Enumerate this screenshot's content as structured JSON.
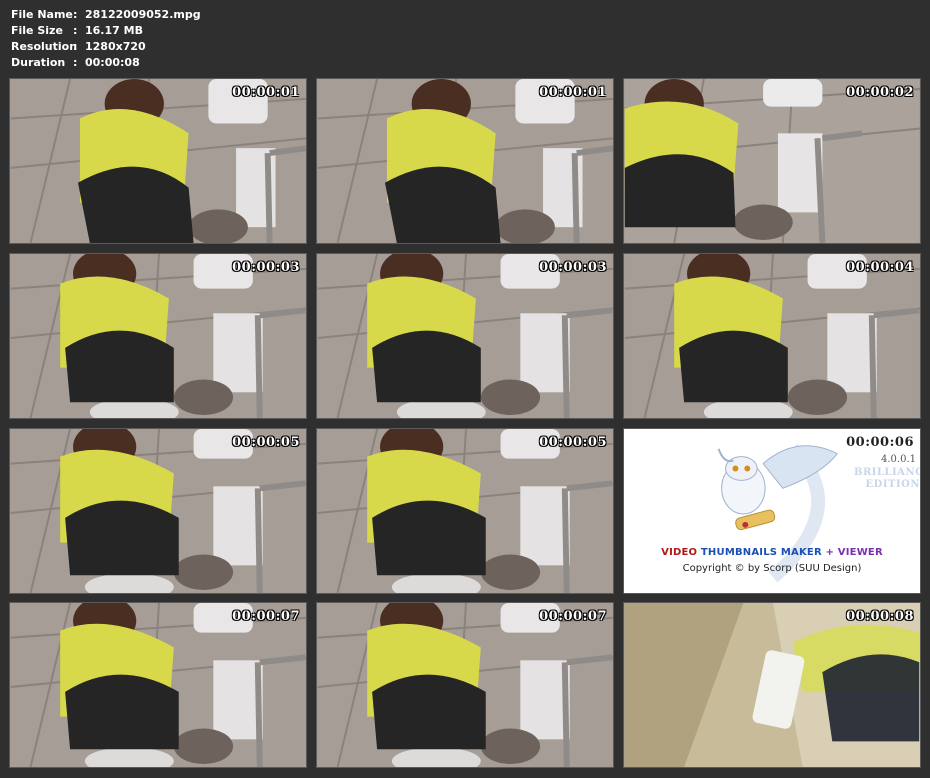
{
  "file_info": [
    {
      "label": "File Name",
      "value": "28122009052.mpg"
    },
    {
      "label": "File Size",
      "value": "16.17 MB"
    },
    {
      "label": "Resolution",
      "value": "1280x720"
    },
    {
      "label": "Duration",
      "value": "00:00:08"
    }
  ],
  "separator": ":",
  "thumbnails": [
    {
      "time": "00:00:01"
    },
    {
      "time": "00:00:01"
    },
    {
      "time": "00:00:02"
    },
    {
      "time": "00:00:03"
    },
    {
      "time": "00:00:03"
    },
    {
      "time": "00:00:04"
    },
    {
      "time": "00:00:05"
    },
    {
      "time": "00:00:05"
    },
    {
      "time": "00:00:06",
      "version": "4.0.0.1",
      "edition_line1": "BRILLIANCE",
      "edition_line2": "EDITION",
      "brand_part1": "VIDEO ",
      "brand_part2": "THUMBNAILS MAKER",
      "brand_part3": " + VIEWER",
      "copyright": "Copyright © by Scorp (SUU Design)"
    },
    {
      "time": "00:00:07"
    },
    {
      "time": "00:00:07"
    },
    {
      "time": "00:00:08"
    }
  ],
  "colors": {
    "background": "#2f2f2f",
    "thumb_border": "#5a5a5a",
    "text": "#ffffff"
  }
}
